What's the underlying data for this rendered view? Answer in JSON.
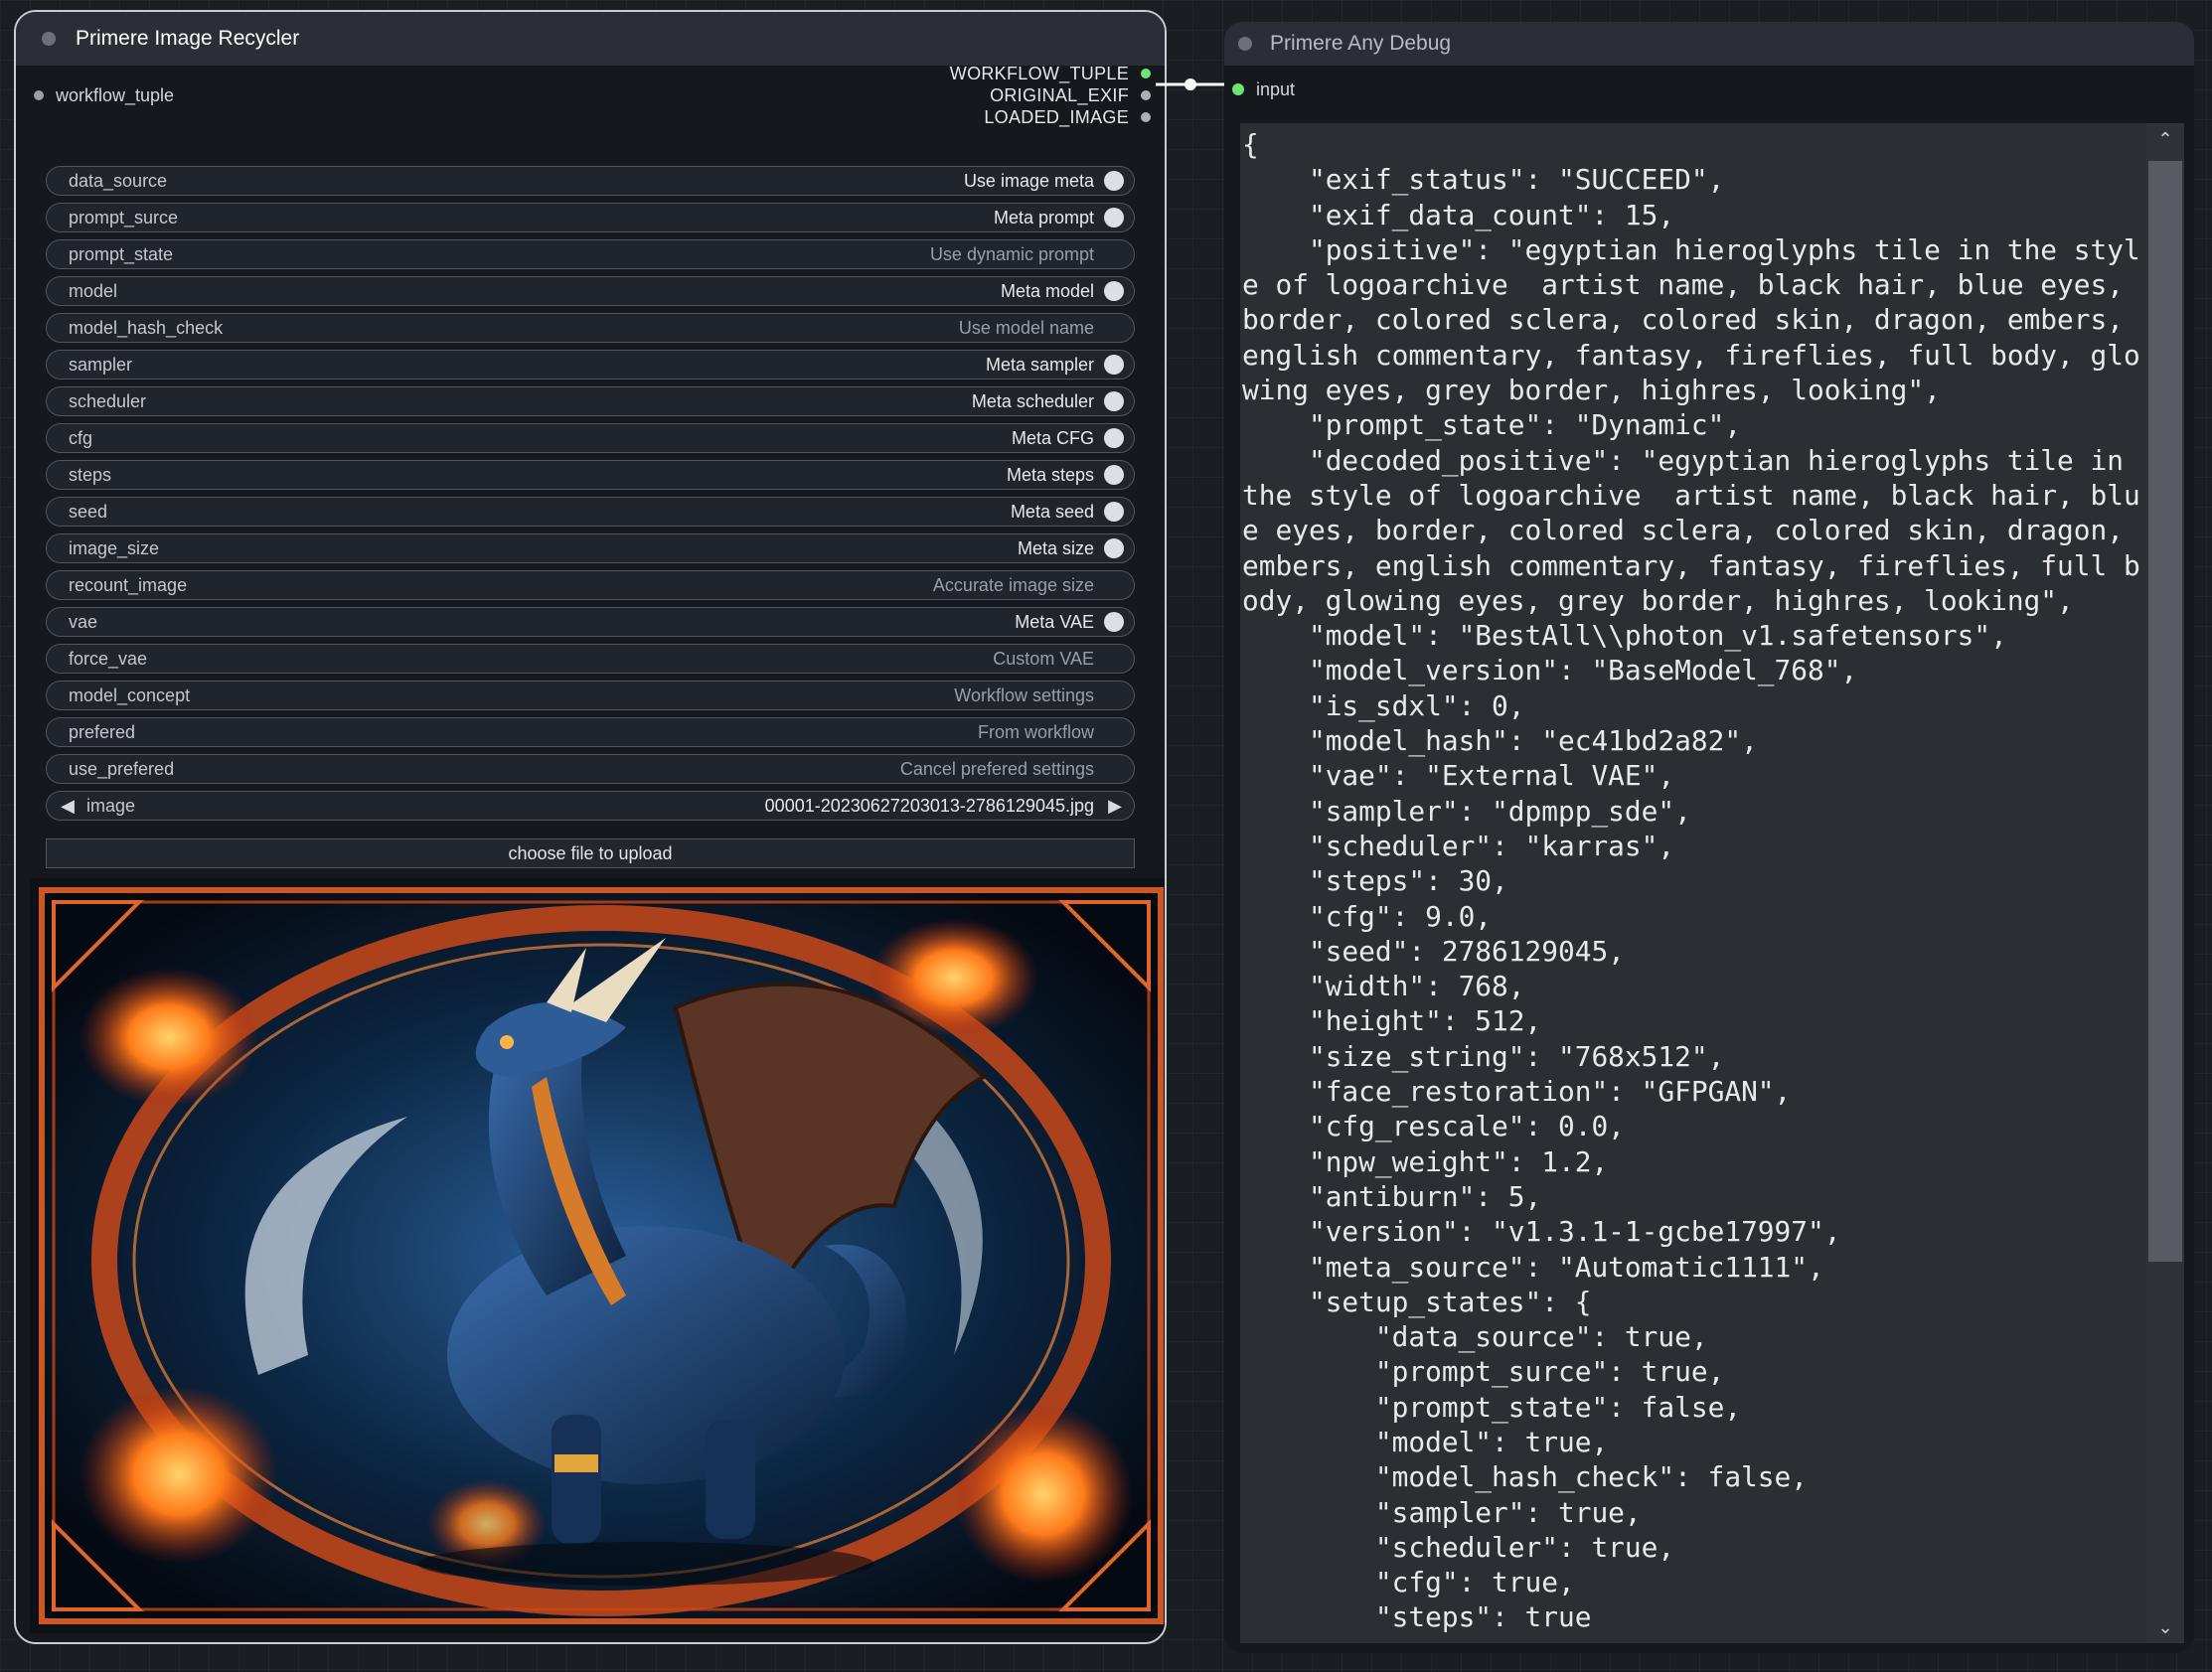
{
  "left_node": {
    "title": "Primere Image Recycler",
    "input_slot": "workflow_tuple",
    "outputs": [
      "WORKFLOW_TUPLE",
      "ORIGINAL_EXIF",
      "LOADED_IMAGE"
    ],
    "widgets": [
      {
        "name": "data_source",
        "value": "Use image meta",
        "on": true
      },
      {
        "name": "prompt_surce",
        "value": "Meta prompt",
        "on": true
      },
      {
        "name": "prompt_state",
        "value": "Use dynamic prompt",
        "on": false
      },
      {
        "name": "model",
        "value": "Meta model",
        "on": true
      },
      {
        "name": "model_hash_check",
        "value": "Use model name",
        "on": false
      },
      {
        "name": "sampler",
        "value": "Meta sampler",
        "on": true
      },
      {
        "name": "scheduler",
        "value": "Meta scheduler",
        "on": true
      },
      {
        "name": "cfg",
        "value": "Meta CFG",
        "on": true
      },
      {
        "name": "steps",
        "value": "Meta steps",
        "on": true
      },
      {
        "name": "seed",
        "value": "Meta seed",
        "on": true
      },
      {
        "name": "image_size",
        "value": "Meta size",
        "on": true
      },
      {
        "name": "recount_image",
        "value": "Accurate image size",
        "on": false
      },
      {
        "name": "vae",
        "value": "Meta VAE",
        "on": true
      },
      {
        "name": "force_vae",
        "value": "Custom VAE",
        "on": false
      },
      {
        "name": "model_concept",
        "value": "Workflow settings",
        "on": false
      },
      {
        "name": "prefered",
        "value": "From workflow",
        "on": false
      },
      {
        "name": "use_prefered",
        "value": "Cancel prefered settings",
        "on": false
      }
    ],
    "image_combo": {
      "name": "image",
      "value": "00001-20230627203013-2786129045.jpg"
    },
    "upload_label": "choose file to upload"
  },
  "right_node": {
    "title": "Primere Any Debug",
    "input_slot": "input",
    "debug_text": "{\n    \"exif_status\": \"SUCCEED\",\n    \"exif_data_count\": 15,\n    \"positive\": \"egyptian hieroglyphs tile in the style of logoarchive  artist name, black hair, blue eyes, border, colored sclera, colored skin, dragon, embers, english commentary, fantasy, fireflies, full body, glowing eyes, grey border, highres, looking\",\n    \"prompt_state\": \"Dynamic\",\n    \"decoded_positive\": \"egyptian hieroglyphs tile in the style of logoarchive  artist name, black hair, blue eyes, border, colored sclera, colored skin, dragon, embers, english commentary, fantasy, fireflies, full body, glowing eyes, grey border, highres, looking\",\n    \"model\": \"BestAll\\\\photon_v1.safetensors\",\n    \"model_version\": \"BaseModel_768\",\n    \"is_sdxl\": 0,\n    \"model_hash\": \"ec41bd2a82\",\n    \"vae\": \"External VAE\",\n    \"sampler\": \"dpmpp_sde\",\n    \"scheduler\": \"karras\",\n    \"steps\": 30,\n    \"cfg\": 9.0,\n    \"seed\": 2786129045,\n    \"width\": 768,\n    \"height\": 512,\n    \"size_string\": \"768x512\",\n    \"face_restoration\": \"GFPGAN\",\n    \"cfg_rescale\": 0.0,\n    \"npw_weight\": 1.2,\n    \"antiburn\": 5,\n    \"version\": \"v1.3.1-1-gcbe17997\",\n    \"meta_source\": \"Automatic1111\",\n    \"setup_states\": {\n        \"data_source\": true,\n        \"prompt_surce\": true,\n        \"prompt_state\": false,\n        \"model\": true,\n        \"model_hash_check\": false,\n        \"sampler\": true,\n        \"scheduler\": true,\n        \"cfg\": true,\n        \"steps\": true"
  },
  "colors": {
    "canvas": "#1a1d22",
    "node_body": "#15181d",
    "title_bar": "#2b2e36",
    "link": "#ffffff",
    "active_slot": "#6ee56e",
    "debug_bg": "#2b2e33"
  },
  "icons": {
    "combo_prev": "◀",
    "combo_next": "▶",
    "scroll_up": "⌃",
    "scroll_down": "⌄"
  }
}
